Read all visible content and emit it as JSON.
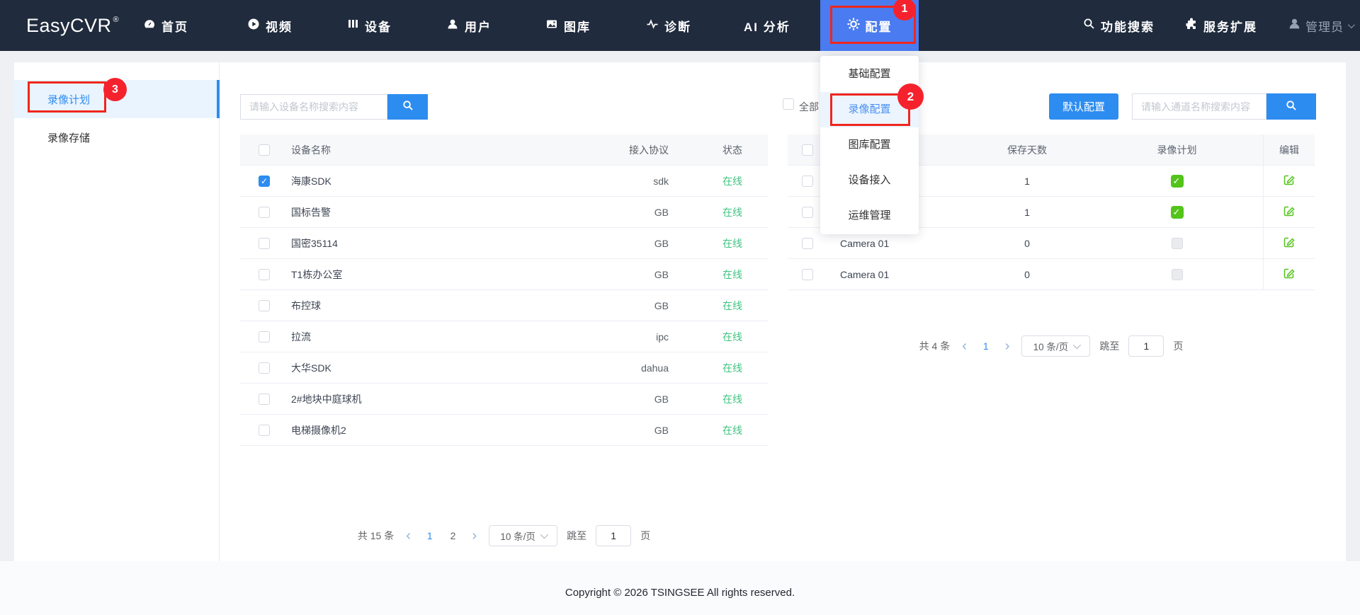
{
  "colors": {
    "accent_blue": "#2d8cf0",
    "config_button_blue": "#4a7bf0",
    "nav_background": "#202b3d",
    "success_green": "#52c41a",
    "online_green": "#3fc380",
    "annotation_red": "#f5222d"
  },
  "nav": {
    "logo": "EasyCVR",
    "logo_mark": "®",
    "items": [
      {
        "label": "首页"
      },
      {
        "label": "视频"
      },
      {
        "label": "设备"
      },
      {
        "label": "用户"
      },
      {
        "label": "图库"
      },
      {
        "label": "诊断"
      },
      {
        "label": "AI 分析"
      },
      {
        "label": "配置"
      }
    ],
    "search_label": "功能搜索",
    "extend_label": "服务扩展",
    "user_label": "管理员"
  },
  "dropdown": {
    "items": [
      {
        "label": "基础配置"
      },
      {
        "label": "录像配置"
      },
      {
        "label": "图库配置"
      },
      {
        "label": "设备接入"
      },
      {
        "label": "运维管理"
      }
    ],
    "active": "录像配置"
  },
  "annotations": {
    "step1": "1",
    "step2": "2",
    "step3": "3"
  },
  "sidebar": {
    "items": [
      {
        "label": "录像计划",
        "active": true
      },
      {
        "label": "录像存储",
        "active": false
      }
    ]
  },
  "device_panel": {
    "search_placeholder": "请输入设备名称搜索内容",
    "columns": {
      "name": "设备名称",
      "protocol": "接入协议",
      "status": "状态"
    },
    "rows": [
      {
        "name": "海康SDK",
        "protocol": "sdk",
        "status": "在线",
        "checked": true
      },
      {
        "name": "国标告警",
        "protocol": "GB",
        "status": "在线"
      },
      {
        "name": "国密35114",
        "protocol": "GB",
        "status": "在线"
      },
      {
        "name": "T1栋办公室",
        "protocol": "GB",
        "status": "在线"
      },
      {
        "name": "布控球",
        "protocol": "GB",
        "status": "在线"
      },
      {
        "name": "拉流",
        "protocol": "ipc",
        "status": "在线"
      },
      {
        "name": "大华SDK",
        "protocol": "dahua",
        "status": "在线"
      },
      {
        "name": "2#地块中庭球机",
        "protocol": "GB",
        "status": "在线"
      },
      {
        "name": "电梯摄像机2",
        "protocol": "GB",
        "status": "在线"
      }
    ],
    "pagination": {
      "total": "共 15 条",
      "chevron_left": "‹",
      "chevron_right": "›",
      "pages": [
        "1",
        "2"
      ],
      "current": "1",
      "page_size": "10 条/页",
      "jump_label": "跳至",
      "jump_value": "1",
      "unit": "页"
    }
  },
  "channel_panel": {
    "select_all_label": "全部",
    "default_button": "默认配置",
    "search_placeholder": "请输入通道名称搜索内容",
    "columns": {
      "name": "",
      "days": "保存天数",
      "plan": "录像计划",
      "edit": "编辑"
    },
    "rows": [
      {
        "name": "",
        "days": "1",
        "plan": true
      },
      {
        "name": "",
        "days": "1",
        "plan": true
      },
      {
        "name": "Camera 01",
        "days": "0",
        "plan": false
      },
      {
        "name": "Camera 01",
        "days": "0",
        "plan": false
      }
    ],
    "pagination": {
      "total": "共 4 条",
      "chevron_left": "‹",
      "chevron_right": "›",
      "pages": [
        "1"
      ],
      "current": "1",
      "page_size": "10 条/页",
      "jump_label": "跳至",
      "jump_value": "1",
      "unit": "页"
    }
  },
  "footer": {
    "copyright": "Copyright © 2026 TSINGSEE All rights reserved."
  }
}
